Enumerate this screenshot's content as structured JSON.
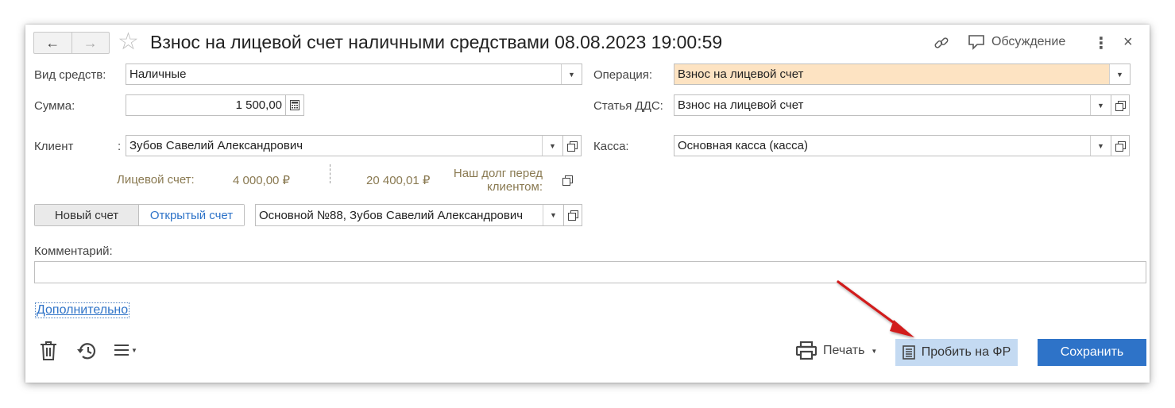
{
  "header": {
    "back_icon": "←",
    "forward_icon": "→",
    "star_icon": "☆",
    "title": "Взнос на лицевой счет наличными средствами 08.08.2023 19:00:59",
    "discussion_label": "Обсуждение",
    "more_icon": "⋮",
    "close_icon": "×"
  },
  "form": {
    "fund_type_label": "Вид средств:",
    "fund_type_value": "Наличные",
    "amount_label": "Сумма:",
    "amount_value": "1 500,00",
    "client_label": "Клиент",
    "client_colon": ":",
    "client_value": "Зубов Савелий Александрович",
    "operation_label": "Операция:",
    "operation_value": "Взнос на лицевой счет",
    "dds_label": "Статья ДДС:",
    "dds_value": "Взнос на лицевой счет",
    "cash_label": "Касса:",
    "cash_value": "Основная касса (касса)"
  },
  "balances": {
    "account_label": "Лицевой счет:",
    "account_value": "4 000,00 ₽",
    "debt_value": "20 400,01 ₽",
    "debt_label_line1": "Наш долг перед",
    "debt_label_line2": "клиентом:"
  },
  "account_tabs": {
    "new_label": "Новый счет",
    "open_label": "Открытый счет",
    "selected_account": "Основной №88, Зубов Савелий Александрович"
  },
  "comment": {
    "label": "Комментарий:",
    "value": ""
  },
  "extra_link": "Дополнительно",
  "footer": {
    "print_label": "Печать",
    "fiscal_label": "Пробить на ФР",
    "save_label": "Сохранить"
  },
  "colors": {
    "accent": "#2e73c8",
    "highlight_field": "#fde3c2",
    "fiscal_button": "#c4daf2",
    "annotation_arrow": "#d11a1a"
  }
}
